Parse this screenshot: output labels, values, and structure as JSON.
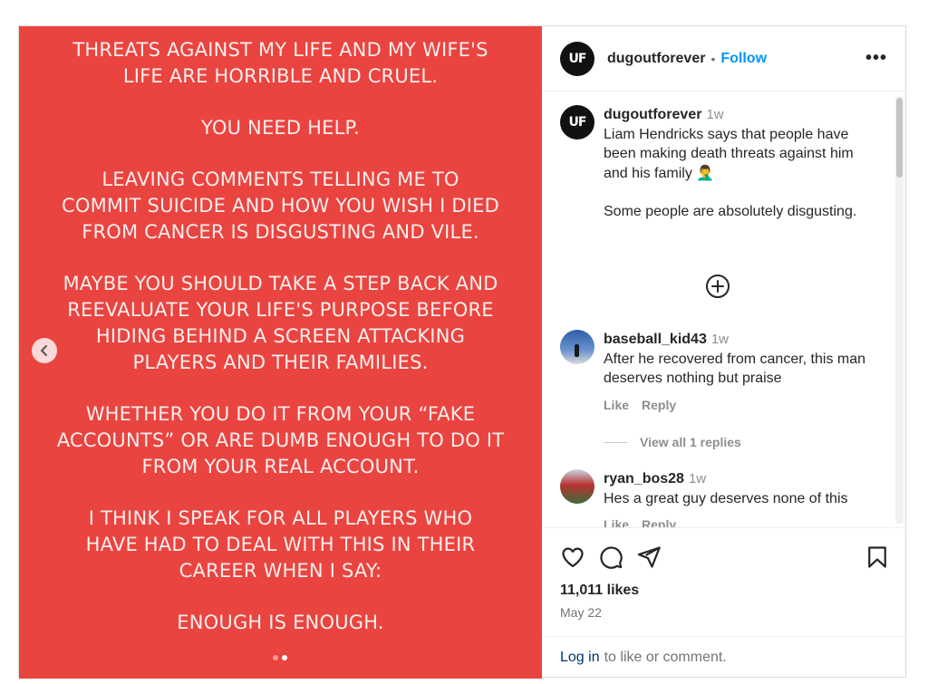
{
  "media": {
    "paragraphs": [
      "THREATS AGAINST MY LIFE AND MY WIFE'S\nLIFE ARE HORRIBLE AND CRUEL.",
      "YOU NEED HELP.",
      "LEAVING COMMENTS TELLING ME TO\nCOMMIT SUICIDE AND HOW YOU WISH I DIED\nFROM CANCER IS DISGUSTING AND VILE.",
      "MAYBE YOU SHOULD TAKE A STEP BACK AND\nREEVALUATE YOUR LIFE'S PURPOSE BEFORE\nHIDING BEHIND A SCREEN ATTACKING\nPLAYERS AND THEIR FAMILIES.",
      "WHETHER YOU DO IT FROM YOUR “FAKE\nACCOUNTS” OR ARE DUMB ENOUGH TO DO IT\nFROM YOUR REAL ACCOUNT.",
      "I THINK I SPEAK FOR ALL PLAYERS WHO\nHAVE  HAD TO DEAL WITH THIS IN THEIR\nCAREER WHEN I SAY:",
      "ENOUGH IS ENOUGH."
    ],
    "background_color": "#ea4440",
    "carousel": {
      "count": 2,
      "active_index": 1
    },
    "prev_icon": "chevron-left-icon"
  },
  "header": {
    "avatar_text": "UF",
    "username": "dugoutforever",
    "separator": "•",
    "follow_label": "Follow",
    "more_label": "•••"
  },
  "caption": {
    "username": "dugoutforever",
    "time": "1w",
    "text_line1": "Liam Hendricks says that people have been making death threats against him and his family 🤦‍♂️",
    "text_line2": "Some people are absolutely disgusting."
  },
  "comments": [
    {
      "username": "baseball_kid43",
      "time": "1w",
      "text": "After he recovered from cancer, this man deserves nothing but praise",
      "like_label": "Like",
      "reply_label": "Reply",
      "view_replies": "View all 1 replies"
    },
    {
      "username": "ryan_bos28",
      "time": "1w",
      "text": "Hes a great guy deserves none of this",
      "like_label": "Like",
      "reply_label": "Reply"
    }
  ],
  "footer": {
    "likes": "11,011 likes",
    "date": "May 22",
    "login_link": "Log in",
    "login_suffix": "to like or comment."
  },
  "colors": {
    "accent": "#0095f6",
    "link": "#00376b",
    "muted": "#8e8e8e"
  }
}
